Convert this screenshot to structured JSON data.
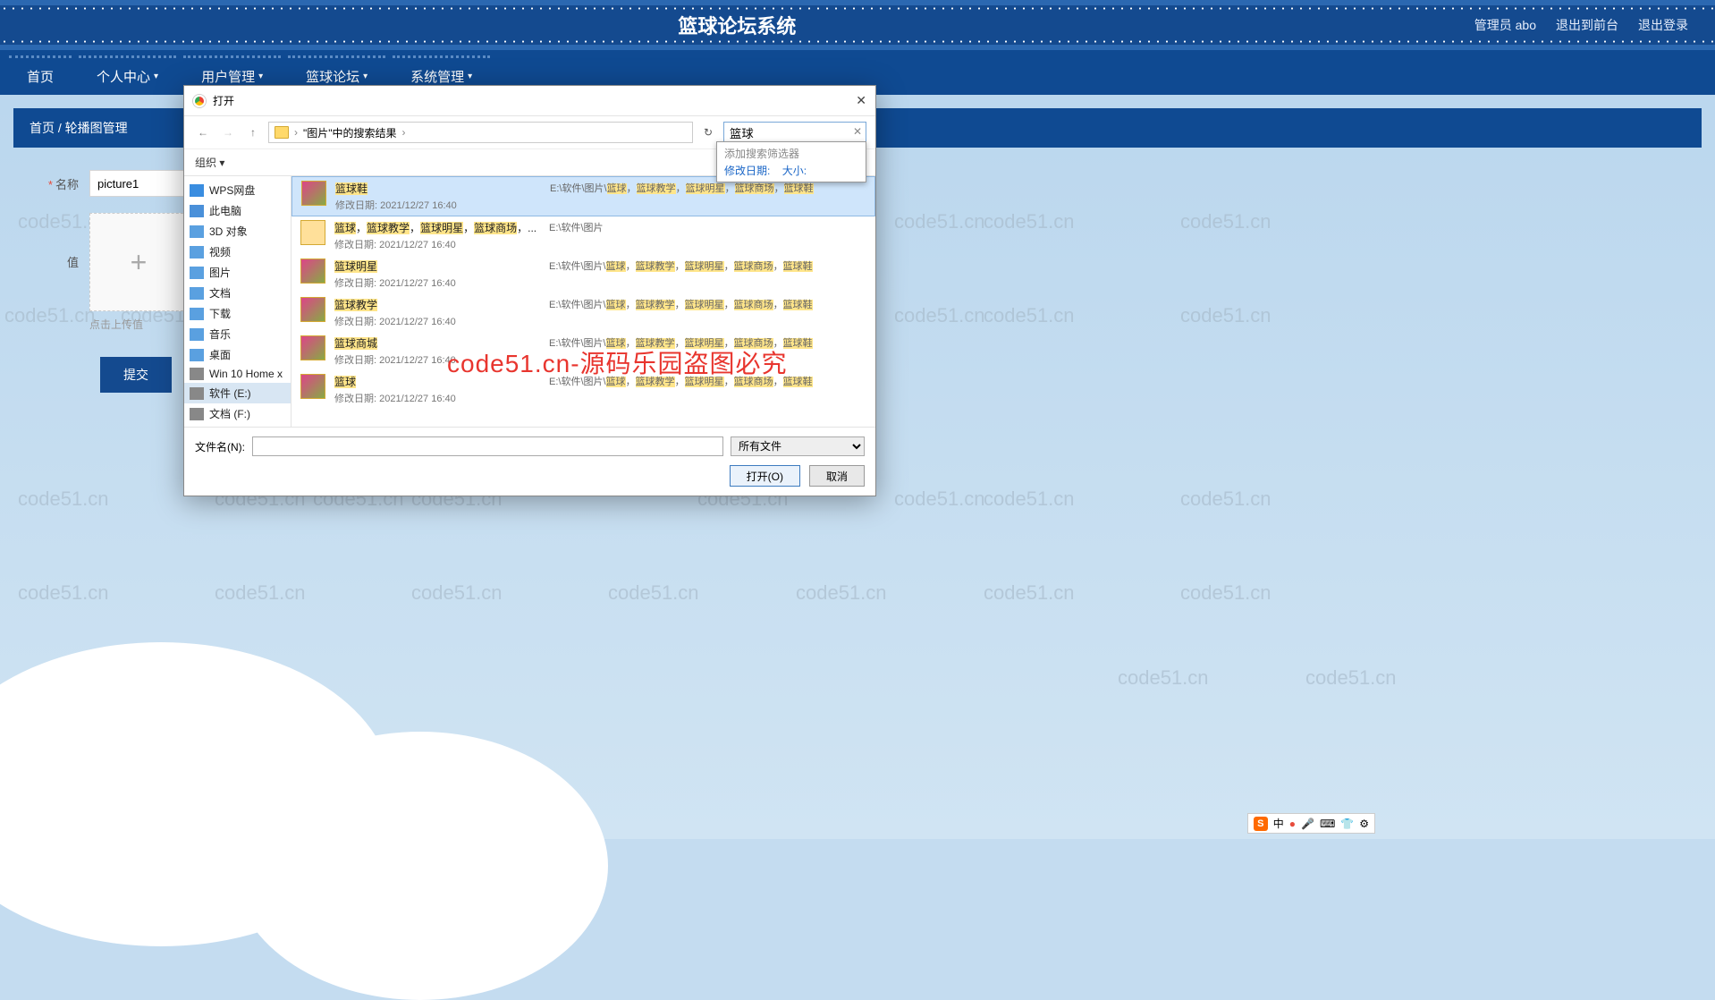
{
  "watermark": "code51.cn",
  "header": {
    "title": "篮球论坛系统",
    "user": "管理员 abo",
    "exit_front": "退出到前台",
    "logout": "退出登录"
  },
  "nav": {
    "home": "首页",
    "personal": "个人中心",
    "user_mgmt": "用户管理",
    "forum": "篮球论坛",
    "system": "系统管理"
  },
  "breadcrumb": {
    "home": "首页",
    "sep": "/",
    "current": "轮播图管理"
  },
  "form": {
    "name_label": "名称",
    "name_value": "picture1",
    "value_label": "值",
    "upload_hint": "点击上传值",
    "submit": "提交"
  },
  "dialog": {
    "title": "打开",
    "path": "\"图片\"中的搜索结果",
    "search_value": "篮球",
    "filter_hint": "添加搜索筛选器",
    "filter_date": "修改日期:",
    "filter_size": "大小:",
    "organize": "组织 ▾",
    "file_label": "文件名(N):",
    "file_value": "",
    "filetype": "所有文件",
    "open_btn": "打开(O)",
    "cancel_btn": "取消",
    "tree": [
      {
        "label": "WPS网盘",
        "icon": "#3a8de0"
      },
      {
        "label": "此电脑",
        "icon": "#4a90d9"
      },
      {
        "label": "3D 对象",
        "icon": "#5aa0e0"
      },
      {
        "label": "视频",
        "icon": "#5aa0e0"
      },
      {
        "label": "图片",
        "icon": "#5aa0e0"
      },
      {
        "label": "文档",
        "icon": "#5aa0e0"
      },
      {
        "label": "下载",
        "icon": "#5aa0e0"
      },
      {
        "label": "音乐",
        "icon": "#5aa0e0"
      },
      {
        "label": "桌面",
        "icon": "#5aa0e0"
      },
      {
        "label": "Win 10 Home x",
        "icon": "#888"
      },
      {
        "label": "软件 (E:)",
        "icon": "#888",
        "selected": true
      },
      {
        "label": "文档 (F:)",
        "icon": "#888"
      }
    ],
    "files": [
      {
        "name": "篮球鞋",
        "date": "修改日期: 2021/12/27 16:40",
        "path": "E:\\软件\\图片\\篮球，篮球教学，篮球明星，篮球商场，篮球鞋",
        "selected": true,
        "img": true
      },
      {
        "name": "篮球，篮球教学，篮球明星，篮球商场，...",
        "date": "修改日期: 2021/12/27 16:40",
        "path": "E:\\软件\\图片",
        "folder": true
      },
      {
        "name": "篮球明星",
        "date": "修改日期: 2021/12/27 16:40",
        "path": "E:\\软件\\图片\\篮球，篮球教学，篮球明星，篮球商场，篮球鞋",
        "img": true
      },
      {
        "name": "篮球教学",
        "date": "修改日期: 2021/12/27 16:40",
        "path": "E:\\软件\\图片\\篮球，篮球教学，篮球明星，篮球商场，篮球鞋",
        "img": true
      },
      {
        "name": "篮球商城",
        "date": "修改日期: 2021/12/27 16:40",
        "path": "E:\\软件\\图片\\篮球，篮球教学，篮球明星，篮球商场，篮球鞋",
        "img": true
      },
      {
        "name": "篮球",
        "date": "修改日期: 2021/12/27 16:40",
        "path": "E:\\软件\\图片\\篮球，篮球教学，篮球明星，篮球商场，篮球鞋",
        "img": true
      }
    ]
  },
  "red_overlay": "code51.cn-源码乐园盗图必究",
  "ime": {
    "s": "S",
    "lang": "中",
    "items": [
      "🎤",
      "⌨",
      "👕",
      "⚙"
    ]
  }
}
